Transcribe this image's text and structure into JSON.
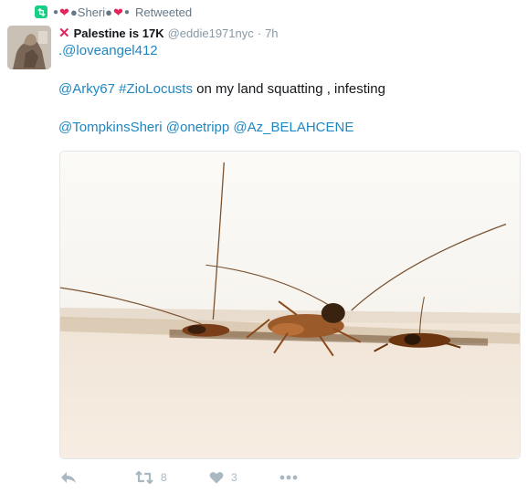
{
  "retweet_context": {
    "name_prefix": "●",
    "name_mid": "●Sheri●",
    "name_suffix": "●",
    "label": "Retweeted"
  },
  "author": {
    "display_name": "Palestine is 17K",
    "handle": "@eddie1971nyc",
    "separator": "·",
    "time": "7h"
  },
  "tweet": {
    "line1_link": ".@loveangel412",
    "line2_mention": "@Arky67",
    "line2_hashtag": "#ZioLocusts",
    "line2_text": " on my land squatting , infesting",
    "line3_mention1": "@TompkinsSheri",
    "line3_mention2": "@onetripp",
    "line3_mention3": "@Az_BELAHCENE"
  },
  "actions": {
    "retweet_count": "8",
    "like_count": "3"
  },
  "icons": {
    "retweet_badge": "retweet-icon",
    "reply": "reply-icon",
    "retweet": "retweet-icon",
    "like": "heart-icon",
    "more": "more-icon"
  },
  "colors": {
    "link": "#1b95e0",
    "retweet_green": "#19cf86",
    "heart_red": "#e0245e",
    "muted": "#8899a6",
    "action_gray": "#aab8c2"
  }
}
